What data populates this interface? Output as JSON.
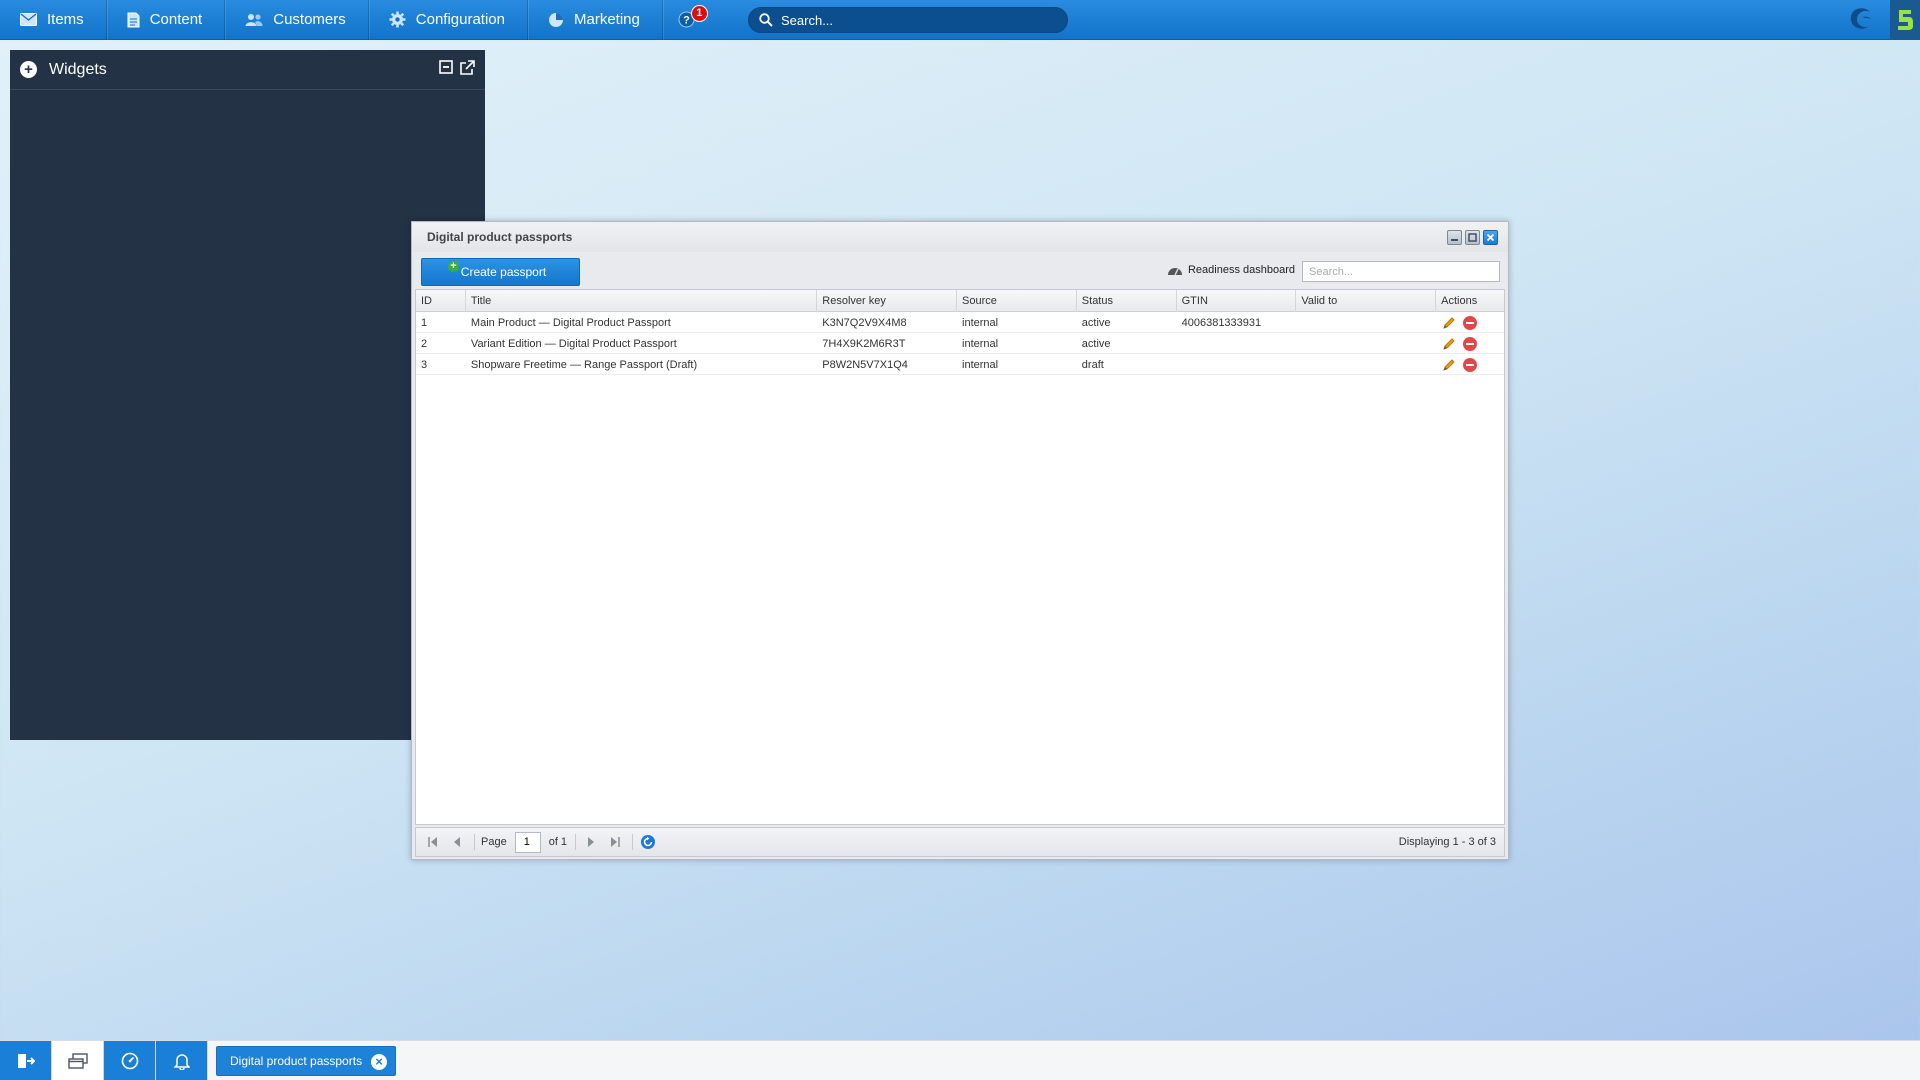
{
  "topbar": {
    "menu": [
      {
        "label": "Items",
        "icon": "envelope-icon"
      },
      {
        "label": "Content",
        "icon": "document-icon"
      },
      {
        "label": "Customers",
        "icon": "users-icon"
      },
      {
        "label": "Configuration",
        "icon": "gear-icon"
      },
      {
        "label": "Marketing",
        "icon": "pie-chart-icon"
      }
    ],
    "help_badge": "1",
    "search_placeholder": "Search..."
  },
  "widgets": {
    "title": "Widgets"
  },
  "window": {
    "title": "Digital product passports",
    "create_button": "Create passport",
    "readiness_label": "Readiness dashboard",
    "search_placeholder": "Search...",
    "columns": [
      "ID",
      "Title",
      "Resolver key",
      "Source",
      "Status",
      "GTIN",
      "Valid to",
      "Actions"
    ],
    "rows": [
      {
        "id": "1",
        "title": "Main Product — Digital Product Passport",
        "key": "K3N7Q2V9X4M8",
        "source": "internal",
        "status": "active",
        "gtin": "4006381333931",
        "valid_to": ""
      },
      {
        "id": "2",
        "title": "Variant Edition — Digital Product Passport",
        "key": "7H4X9K2M6R3T",
        "source": "internal",
        "status": "active",
        "gtin": "",
        "valid_to": ""
      },
      {
        "id": "3",
        "title": "Shopware Freetime — Range Passport (Draft)",
        "key": "P8W2N5V7X1Q4",
        "source": "internal",
        "status": "draft",
        "gtin": "",
        "valid_to": ""
      }
    ],
    "pager": {
      "page_label": "Page",
      "page_value": "1",
      "of_label": "of 1",
      "displaying": "Displaying 1 - 3 of 3"
    }
  },
  "taskbar": {
    "task_label": "Digital product passports"
  },
  "colors": {
    "topbar": "#1a7fd6",
    "widgets_bg": "#233245",
    "accent": "#1d82d8",
    "delete": "#e34848",
    "edit": "#e8a21a"
  }
}
